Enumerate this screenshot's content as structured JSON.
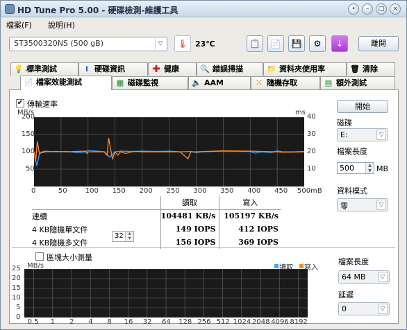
{
  "window": {
    "title": "HD Tune Pro  5.00 - 硬碟檢測-維護工具"
  },
  "menu": [
    {
      "label": "檔案(F)"
    },
    {
      "label": "說明(H)"
    }
  ],
  "toolbar": {
    "drive": "ST3500320NS (500 gB)",
    "temperature": "23℃",
    "exit_label": "離開"
  },
  "tabs_row1": [
    {
      "label": "標準測試",
      "icon": "chart-icon"
    },
    {
      "label": "硬碟資訊",
      "icon": "info-icon"
    },
    {
      "label": "健康",
      "icon": "health-cross-icon"
    },
    {
      "label": "錯誤掃描",
      "icon": "magnifier-icon"
    },
    {
      "label": "資料夾使用率",
      "icon": "folder-icon"
    },
    {
      "label": "清除",
      "icon": "trash-icon"
    }
  ],
  "tabs_row2": [
    {
      "label": "檔案效能測試",
      "icon": "file-icon",
      "active": true
    },
    {
      "label": "磁碟監視",
      "icon": "monitor-icon"
    },
    {
      "label": "AAM",
      "icon": "speaker-icon"
    },
    {
      "label": "隨機存取",
      "icon": "random-icon"
    },
    {
      "label": "額外測試",
      "icon": "grid-icon"
    }
  ],
  "top": {
    "transfer_checkbox": "傳輸速率",
    "transfer_checked": true,
    "start_label": "開始",
    "drive_label": "磁碟",
    "drive_value": "E:",
    "file_length_label": "檔案長度",
    "file_length_value": "500",
    "file_length_unit": "MB",
    "mode_label": "資料模式",
    "mode_value": "零",
    "y_unit_left": "MB/s",
    "y_unit_right": "ms"
  },
  "results": {
    "header_read": "讀取",
    "header_write": "寫入",
    "rows": [
      {
        "label": "連續",
        "read": "104481 KB/s",
        "write": "105197 KB/s"
      },
      {
        "label": "4 KB隨機單文件",
        "read": "149 IOPS",
        "write": "412 IOPS"
      },
      {
        "label": "4 KB隨機多文件",
        "read": "156 IOPS",
        "write": "369 IOPS"
      }
    ],
    "multi_files": "32"
  },
  "bottom": {
    "block_checkbox": "區塊大小測量",
    "block_checked": false,
    "y_unit": "MB/s",
    "legend_read": "讀取",
    "legend_write": "寫入",
    "file_length_label": "檔案長度",
    "file_length_value": "64 MB",
    "delay_label": "延遲",
    "delay_value": "0"
  },
  "colors": {
    "read": "#3aa8ff",
    "write": "#ff8a1f",
    "grid": "#6a6a6a",
    "bg": "#1a1a1a"
  },
  "chart_data": [
    {
      "type": "line",
      "title": "",
      "xlabel": "",
      "ylabel": "MB/s",
      "y2label": "ms",
      "x_ticks": [
        "0",
        "50",
        "100",
        "150",
        "200",
        "250",
        "300",
        "350",
        "400",
        "450",
        "500mB"
      ],
      "y_ticks": [
        50,
        100,
        150,
        200
      ],
      "y2_ticks": [
        10,
        20,
        30,
        40
      ],
      "xlim": [
        0,
        500
      ],
      "ylim": [
        0,
        200
      ],
      "y2lim": [
        0,
        40
      ],
      "series": [
        {
          "name": "讀取",
          "x": [
            0,
            5,
            10,
            15,
            20,
            40,
            60,
            80,
            95,
            100,
            130,
            140,
            150,
            160,
            180,
            200,
            230,
            250,
            270,
            290,
            300,
            310,
            350,
            400,
            410,
            420,
            440,
            450,
            460,
            480,
            500
          ],
          "values": [
            100,
            60,
            95,
            100,
            102,
            100,
            101,
            98,
            100,
            104,
            100,
            85,
            100,
            102,
            101,
            102,
            101,
            102,
            100,
            101,
            98,
            100,
            102,
            101,
            96,
            100,
            98,
            103,
            100,
            100,
            101
          ]
        },
        {
          "name": "寫入",
          "x": [
            0,
            3,
            6,
            10,
            20,
            40,
            60,
            95,
            98,
            100,
            130,
            135,
            138,
            145,
            150,
            155,
            160,
            170,
            180,
            190,
            200,
            230,
            270,
            285,
            290,
            300,
            350,
            400,
            420,
            450,
            460,
            500
          ],
          "values": [
            100,
            72,
            130,
            95,
            100,
            101,
            100,
            102,
            95,
            100,
            100,
            90,
            140,
            80,
            100,
            90,
            100,
            95,
            100,
            101,
            100,
            100,
            100,
            80,
            100,
            100,
            103,
            102,
            101,
            100,
            99,
            100
          ]
        }
      ]
    },
    {
      "type": "bar",
      "title": "",
      "ylabel": "MB/s",
      "ylim": [
        0,
        25
      ],
      "y_ticks": [
        0,
        5,
        10,
        15,
        20,
        25
      ],
      "categories": [
        "0.5",
        "1",
        "2",
        "4",
        "8",
        "16",
        "32",
        "64",
        "128",
        "256",
        "512",
        "1024",
        "2048",
        "4096",
        "8192"
      ],
      "series": [
        {
          "name": "讀取",
          "values": []
        },
        {
          "name": "寫入",
          "values": []
        }
      ]
    }
  ]
}
